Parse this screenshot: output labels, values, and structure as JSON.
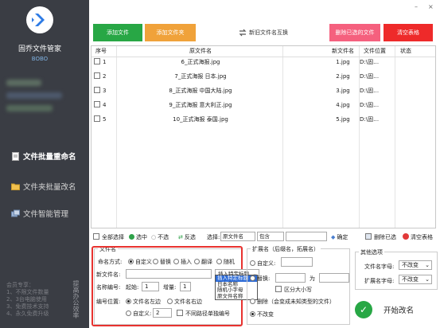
{
  "app": {
    "name": "固乔文件管家",
    "user_tag": "BOBO"
  },
  "window": {
    "minimize": "–",
    "close": "×"
  },
  "sidebar": {
    "items": [
      {
        "label": "文件批量重命名",
        "icon": "document-icon",
        "active": true
      },
      {
        "label": "文件夹批量改名",
        "icon": "folder-icon",
        "active": false
      },
      {
        "label": "文件智能管理",
        "icon": "manage-icon",
        "active": false
      }
    ],
    "member_title": "会员专享：",
    "member_lines": [
      "1、不限文件数量",
      "2、3台电脑使用",
      "3、免费技术支持",
      "4、永久免费升级"
    ],
    "promo": "提高办公效率"
  },
  "toolbar": {
    "add_file": "添加文件",
    "add_folder": "添加文件夹",
    "new_name_swap": "新旧文件名互换",
    "delete_selected": "删除已选的文件",
    "clear_table": "清空表格"
  },
  "table": {
    "headers": {
      "index": "序号",
      "old_name": "原文件名",
      "new_name": "新文件名",
      "location": "文件位置",
      "status": "状态"
    },
    "rows": [
      {
        "index": "1",
        "old": "6_正式海报.jpg",
        "new": "1.jpg",
        "loc": "D:\\固…"
      },
      {
        "index": "2",
        "old": "7_正式海报 日本.jpg",
        "new": "2.jpg",
        "loc": "D:\\固…"
      },
      {
        "index": "3",
        "old": "8_正式海报 中国大陆.jpg",
        "new": "3.jpg",
        "loc": "D:\\固…"
      },
      {
        "index": "4",
        "old": "9_正式海报 意大利正.jpg",
        "new": "4.jpg",
        "loc": "D:\\固…"
      },
      {
        "index": "5",
        "old": "10_正式海报 泰国.jpg",
        "new": "5.jpg",
        "loc": "D:\\固…"
      }
    ]
  },
  "selection": {
    "select_all": "全部选择",
    "check": "选中",
    "uncheck": "不选",
    "invert": "反选",
    "choose_label": "选择:",
    "field_value": "原文件名",
    "op_value": "包含",
    "confirm": "确定",
    "delete_selected": "删除已选",
    "clear_table": "清空表格"
  },
  "filename_panel": {
    "legend": "文件名",
    "mode_label": "命名方式:",
    "modes": [
      "自定义",
      "替换",
      "插入",
      "翻译",
      "随机"
    ],
    "new_name_label": "新文件名:",
    "insert_value": "插入特定标题",
    "dropdown_options": [
      "插入特定标题",
      "日本名称",
      "随机小字母",
      "原文件名称"
    ],
    "numbering_label": "名称编号:",
    "start_label": "起始:",
    "start_value": "1",
    "step_label": "增量:",
    "step_value": "1",
    "position_label": "编号位置:",
    "pos_left": "文件名左边",
    "pos_right": "文件名右边",
    "custom_label": "自定义:",
    "custom_value": "2",
    "separate_label": "不同路径单独编号"
  },
  "extension_panel": {
    "legend": "扩展名（后缀名，拓展名）",
    "custom_label": "自定义:",
    "replace_label": "替换:",
    "as_label": "为",
    "case_label": "区分大小写",
    "delete_label": "删除（会变成未知类型的文件）",
    "nochange_label": "不改变"
  },
  "other_panel": {
    "legend": "其他选项",
    "name_case_label": "文件名字母:",
    "name_case_value": "不改变",
    "ext_case_label": "扩展名字母:",
    "ext_case_value": "不改变"
  },
  "start_button": "开始改名"
}
